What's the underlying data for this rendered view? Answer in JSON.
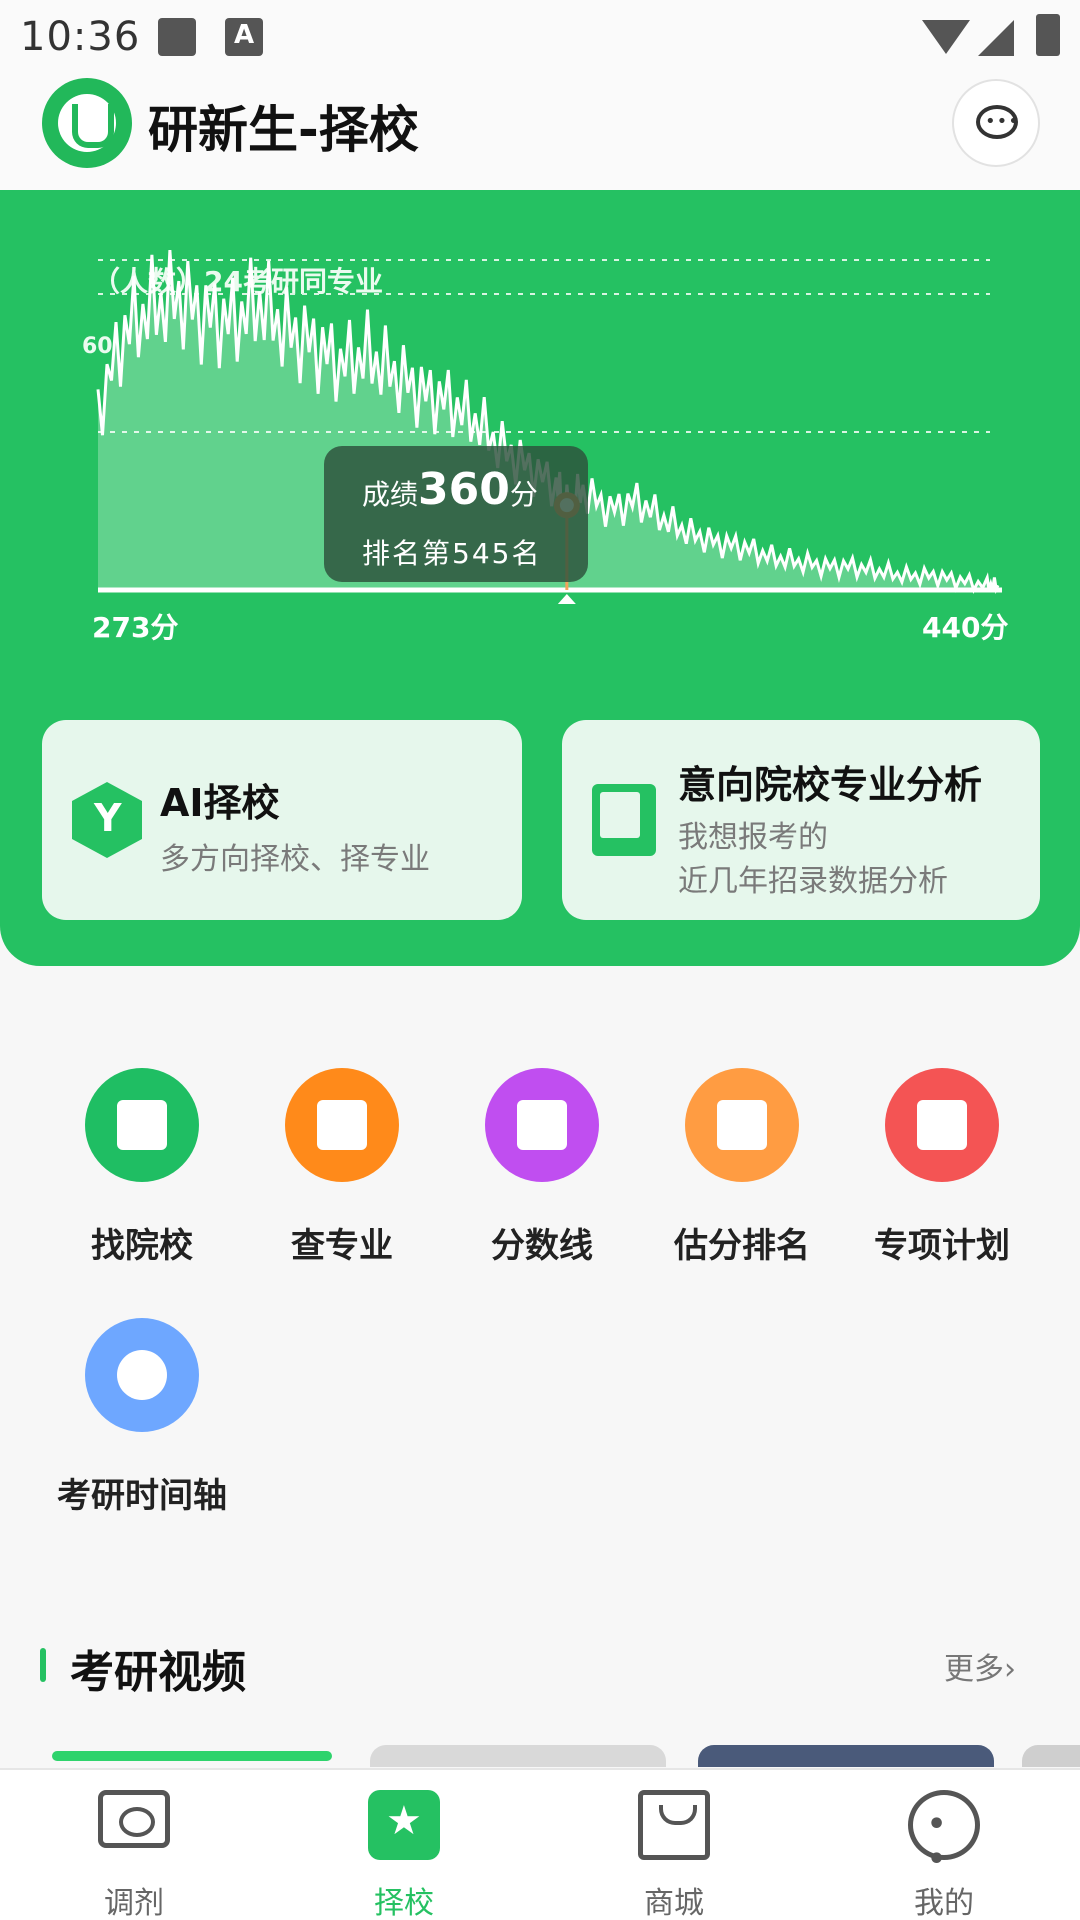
{
  "status_bar": {
    "time": "10:36"
  },
  "header": {
    "title": "研新生-择校"
  },
  "chart_data": {
    "type": "area",
    "title": "（人数）24考研同专业",
    "ytick_label": "60",
    "x_min_label": "273分",
    "x_max_label": "440分",
    "x": [
      273,
      278,
      283,
      288,
      293,
      298,
      303,
      308,
      313,
      318,
      323,
      328,
      333,
      338,
      343,
      348,
      353,
      358,
      360,
      363,
      368,
      373,
      378,
      383,
      388,
      393,
      398,
      403,
      408,
      413,
      418,
      423,
      428,
      433,
      438,
      440
    ],
    "values": [
      38,
      55,
      60,
      62,
      58,
      57,
      61,
      55,
      52,
      48,
      50,
      46,
      42,
      40,
      36,
      30,
      26,
      22,
      18,
      21,
      17,
      19,
      15,
      12,
      10,
      9,
      7,
      6,
      5,
      5,
      4,
      3,
      3,
      2,
      1,
      1
    ],
    "ylim": [
      0,
      70
    ],
    "highlight": {
      "x": 360,
      "score_prefix": "成绩",
      "score_value": "360",
      "score_suffix": "分",
      "rank_text": "排名第545名"
    }
  },
  "cards": {
    "ai": {
      "title": "AI择校",
      "subtitle": "多方向择校、择专业"
    },
    "intent": {
      "title": "意向院校专业分析",
      "subtitle1": "我想报考的",
      "subtitle2": "近几年招录数据分析"
    }
  },
  "grid": {
    "items": [
      {
        "label": "找院校",
        "icon": "university-icon",
        "color": "#1fbe63"
      },
      {
        "label": "查专业",
        "icon": "book-icon",
        "color": "#ff8a1a"
      },
      {
        "label": "分数线",
        "icon": "bar-chart-icon",
        "color": "#c04ef0"
      },
      {
        "label": "估分排名",
        "icon": "ranking-icon",
        "color": "#ff9c42"
      },
      {
        "label": "专项计划",
        "icon": "plan-icon",
        "color": "#f45454"
      },
      {
        "label": "考研时间轴",
        "icon": "alarm-clock-icon",
        "color": "#6ea7ff"
      }
    ]
  },
  "section": {
    "title": "考研视频",
    "more": "更多›"
  },
  "bottom_nav": {
    "items": [
      {
        "label": "调剂",
        "icon": "monitor-eye-icon"
      },
      {
        "label": "择校",
        "icon": "star-icon",
        "active": true
      },
      {
        "label": "商城",
        "icon": "shopping-bag-icon"
      },
      {
        "label": "我的",
        "icon": "smile-face-icon"
      }
    ]
  },
  "colors": {
    "accent": "#25c162",
    "panel": "#25c162",
    "card_bg": "#e6f7ec"
  }
}
